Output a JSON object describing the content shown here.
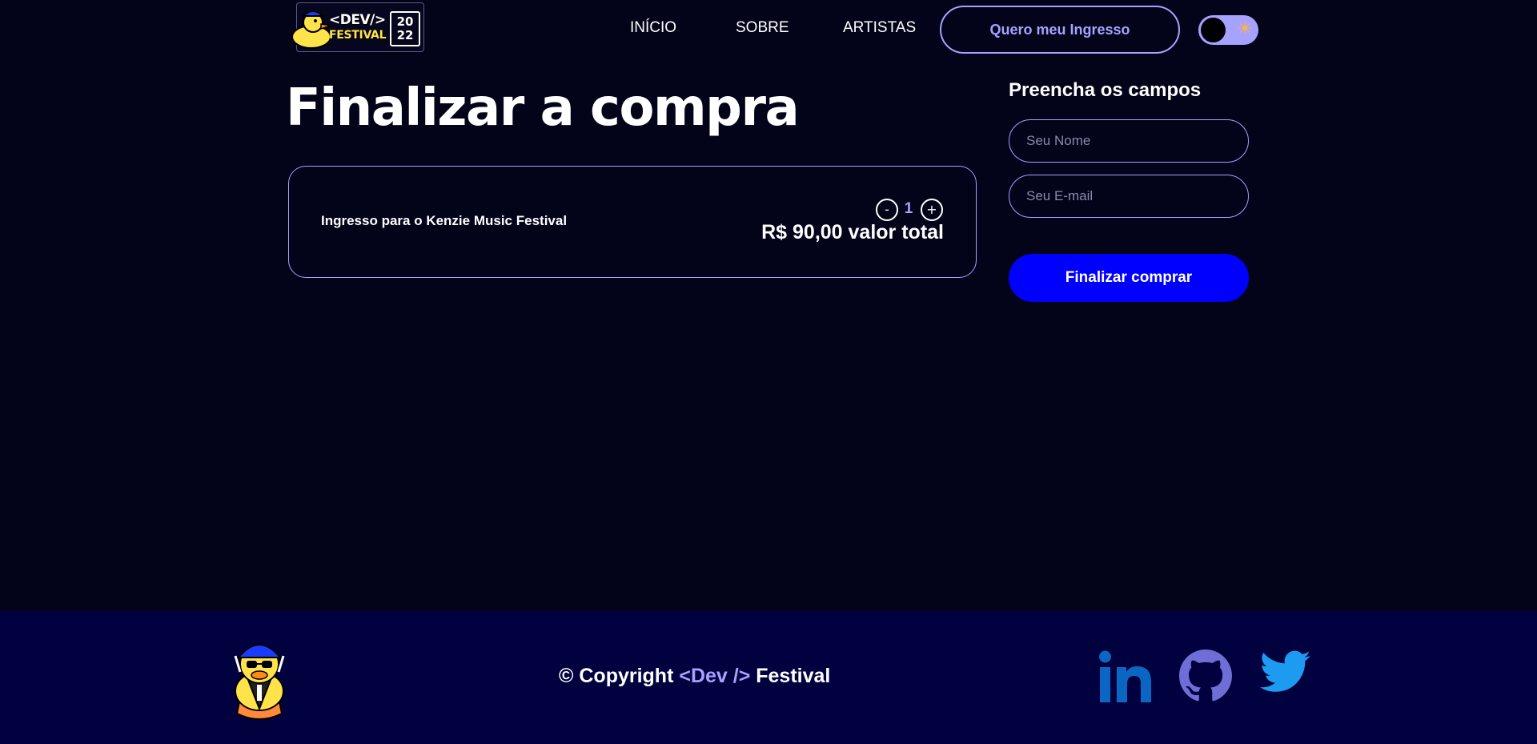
{
  "header": {
    "logo": {
      "dev_text": "<DEV/>",
      "festival_text": "FESTIVAL",
      "year_top": "20",
      "year_bottom": "22"
    },
    "nav": [
      {
        "label": "INÍCIO"
      },
      {
        "label": "SOBRE"
      },
      {
        "label": "ARTISTAS"
      }
    ],
    "ticket_button_label": "Quero meu Ingresso",
    "theme_toggle": {
      "icon": "sun-icon",
      "state": "dark"
    }
  },
  "main": {
    "title": "Finalizar a compra",
    "cart": {
      "item_name": "Ingresso para o Kenzie Music Festival",
      "minus_label": "-",
      "plus_label": "+",
      "quantity": "1",
      "total": "R$ 90,00 valor total"
    },
    "form": {
      "heading": "Preencha os campos",
      "name_placeholder": "Seu Nome",
      "name_value": "",
      "email_placeholder": "Seu E-mail",
      "email_value": "",
      "submit_label": "Finalizar comprar"
    }
  },
  "footer": {
    "copyright_prefix": "© Copyright ",
    "copyright_brand": "<Dev />",
    "copyright_suffix": " Festival",
    "social": [
      {
        "icon": "linkedin-icon",
        "color": "#0a66c2"
      },
      {
        "icon": "github-icon",
        "color": "#6e6ed6"
      },
      {
        "icon": "twitter-icon",
        "color": "#1d9bf0"
      }
    ]
  },
  "colors": {
    "background": "#03031a",
    "footer_background": "#01013f",
    "accent": "#a6a2ff",
    "primary_button": "#0000ff"
  }
}
